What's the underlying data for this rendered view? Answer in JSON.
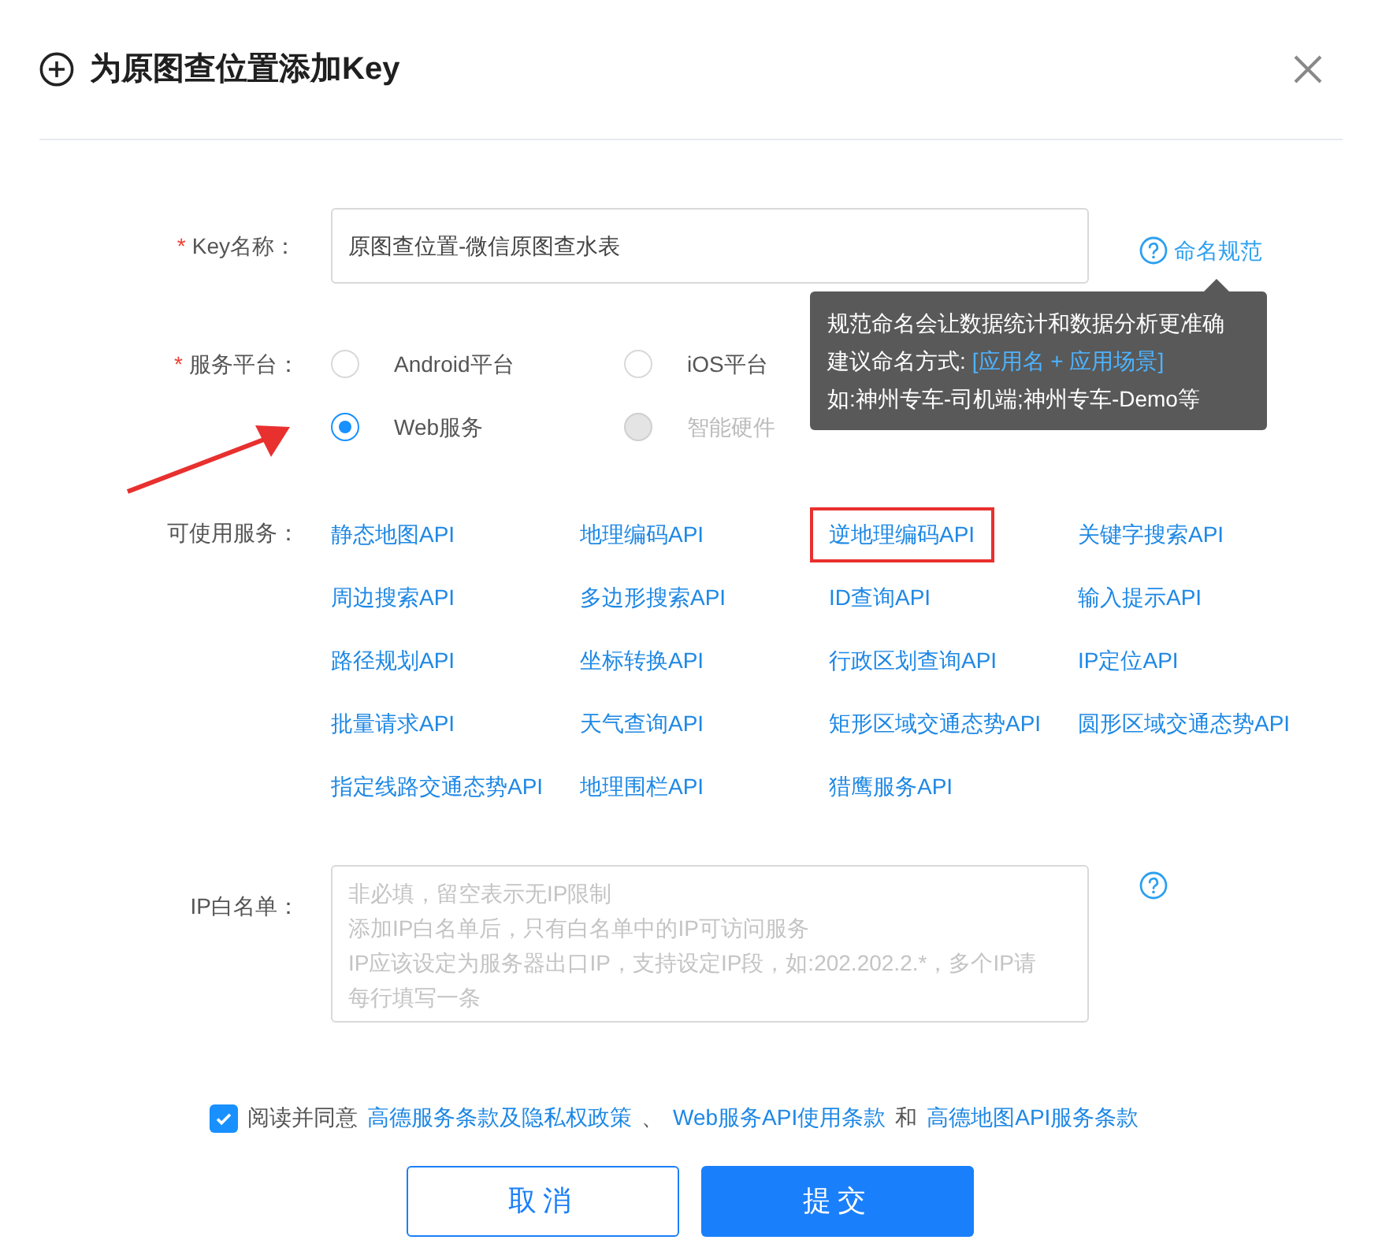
{
  "dialog": {
    "title": "为原图查位置添加Key"
  },
  "key_name": {
    "label": "Key名称：",
    "required_mark": "*",
    "value": "原图查位置-微信原图查水表",
    "help_link": "命名规范"
  },
  "tooltip": {
    "line_1": "规范命名会让数据统计和数据分析更准确",
    "line_2_prefix": "建议命名方式:",
    "line_2_highlight": "[应用名 + 应用场景]",
    "line_3": "如:神州专车-司机端;神州专车-Demo等"
  },
  "platform": {
    "label": "服务平台：",
    "required_mark": "*",
    "options": [
      {
        "label": "Android平台",
        "selected": false,
        "disabled": false
      },
      {
        "label": "iOS平台",
        "selected": false,
        "disabled": false
      },
      {
        "label": "Web服务",
        "selected": true,
        "disabled": false
      },
      {
        "label": "智能硬件",
        "selected": false,
        "disabled": true
      }
    ]
  },
  "services": {
    "label": "可使用服务：",
    "items": [
      {
        "label": "静态地图API",
        "highlighted": false
      },
      {
        "label": "地理编码API",
        "highlighted": false
      },
      {
        "label": "逆地理编码API",
        "highlighted": true
      },
      {
        "label": "关键字搜索API",
        "highlighted": false
      },
      {
        "label": "周边搜索API",
        "highlighted": false
      },
      {
        "label": "多边形搜索API",
        "highlighted": false
      },
      {
        "label": "ID查询API",
        "highlighted": false
      },
      {
        "label": "输入提示API",
        "highlighted": false
      },
      {
        "label": "路径规划API",
        "highlighted": false
      },
      {
        "label": "坐标转换API",
        "highlighted": false
      },
      {
        "label": "行政区划查询API",
        "highlighted": false
      },
      {
        "label": "IP定位API",
        "highlighted": false
      },
      {
        "label": "批量请求API",
        "highlighted": false
      },
      {
        "label": "天气查询API",
        "highlighted": false
      },
      {
        "label": "矩形区域交通态势API",
        "highlighted": false
      },
      {
        "label": "圆形区域交通态势API",
        "highlighted": false
      },
      {
        "label": "指定线路交通态势API",
        "highlighted": false
      },
      {
        "label": "地理围栏API",
        "highlighted": false
      },
      {
        "label": "猎鹰服务API",
        "highlighted": false
      }
    ]
  },
  "ip_whitelist": {
    "label": "IP白名单：",
    "placeholder_lines": [
      "非必填，留空表示无IP限制",
      "添加IP白名单后，只有白名单中的IP可访问服务",
      "IP应该设定为服务器出口IP，支持设定IP段，如:202.202.2.*，多个IP请",
      "每行填写一条"
    ]
  },
  "agreement": {
    "checked": true,
    "prefix": "阅读并同意",
    "links": [
      "高德服务条款及隐私权政策",
      "Web服务API使用条款",
      "高德地图API服务条款"
    ],
    "separator": "、",
    "conjunction": "和"
  },
  "buttons": [
    {
      "label": "取消",
      "kind": "secondary"
    },
    {
      "label": "提交",
      "kind": "primary"
    }
  ]
}
